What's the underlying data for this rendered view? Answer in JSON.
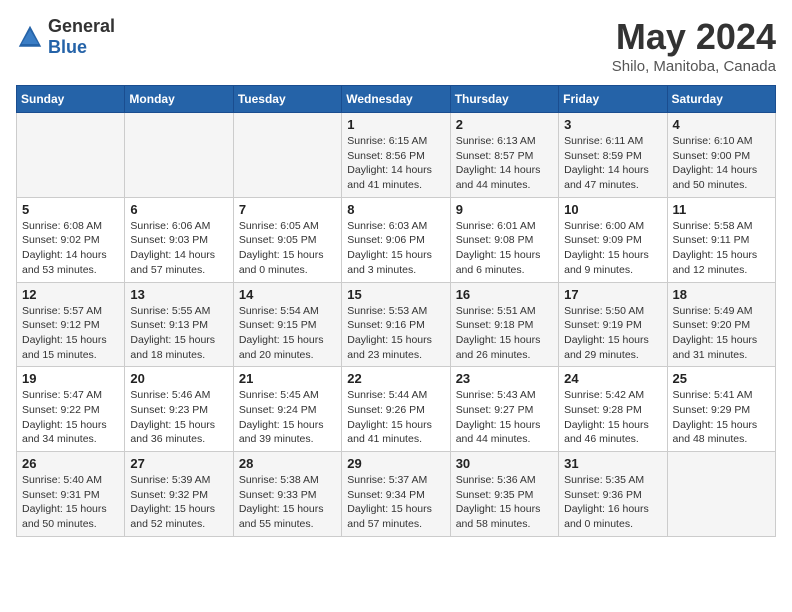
{
  "logo": {
    "text_general": "General",
    "text_blue": "Blue"
  },
  "title": "May 2024",
  "subtitle": "Shilo, Manitoba, Canada",
  "headers": [
    "Sunday",
    "Monday",
    "Tuesday",
    "Wednesday",
    "Thursday",
    "Friday",
    "Saturday"
  ],
  "weeks": [
    [
      {
        "day": "",
        "info": ""
      },
      {
        "day": "",
        "info": ""
      },
      {
        "day": "",
        "info": ""
      },
      {
        "day": "1",
        "info": "Sunrise: 6:15 AM\nSunset: 8:56 PM\nDaylight: 14 hours\nand 41 minutes."
      },
      {
        "day": "2",
        "info": "Sunrise: 6:13 AM\nSunset: 8:57 PM\nDaylight: 14 hours\nand 44 minutes."
      },
      {
        "day": "3",
        "info": "Sunrise: 6:11 AM\nSunset: 8:59 PM\nDaylight: 14 hours\nand 47 minutes."
      },
      {
        "day": "4",
        "info": "Sunrise: 6:10 AM\nSunset: 9:00 PM\nDaylight: 14 hours\nand 50 minutes."
      }
    ],
    [
      {
        "day": "5",
        "info": "Sunrise: 6:08 AM\nSunset: 9:02 PM\nDaylight: 14 hours\nand 53 minutes."
      },
      {
        "day": "6",
        "info": "Sunrise: 6:06 AM\nSunset: 9:03 PM\nDaylight: 14 hours\nand 57 minutes."
      },
      {
        "day": "7",
        "info": "Sunrise: 6:05 AM\nSunset: 9:05 PM\nDaylight: 15 hours\nand 0 minutes."
      },
      {
        "day": "8",
        "info": "Sunrise: 6:03 AM\nSunset: 9:06 PM\nDaylight: 15 hours\nand 3 minutes."
      },
      {
        "day": "9",
        "info": "Sunrise: 6:01 AM\nSunset: 9:08 PM\nDaylight: 15 hours\nand 6 minutes."
      },
      {
        "day": "10",
        "info": "Sunrise: 6:00 AM\nSunset: 9:09 PM\nDaylight: 15 hours\nand 9 minutes."
      },
      {
        "day": "11",
        "info": "Sunrise: 5:58 AM\nSunset: 9:11 PM\nDaylight: 15 hours\nand 12 minutes."
      }
    ],
    [
      {
        "day": "12",
        "info": "Sunrise: 5:57 AM\nSunset: 9:12 PM\nDaylight: 15 hours\nand 15 minutes."
      },
      {
        "day": "13",
        "info": "Sunrise: 5:55 AM\nSunset: 9:13 PM\nDaylight: 15 hours\nand 18 minutes."
      },
      {
        "day": "14",
        "info": "Sunrise: 5:54 AM\nSunset: 9:15 PM\nDaylight: 15 hours\nand 20 minutes."
      },
      {
        "day": "15",
        "info": "Sunrise: 5:53 AM\nSunset: 9:16 PM\nDaylight: 15 hours\nand 23 minutes."
      },
      {
        "day": "16",
        "info": "Sunrise: 5:51 AM\nSunset: 9:18 PM\nDaylight: 15 hours\nand 26 minutes."
      },
      {
        "day": "17",
        "info": "Sunrise: 5:50 AM\nSunset: 9:19 PM\nDaylight: 15 hours\nand 29 minutes."
      },
      {
        "day": "18",
        "info": "Sunrise: 5:49 AM\nSunset: 9:20 PM\nDaylight: 15 hours\nand 31 minutes."
      }
    ],
    [
      {
        "day": "19",
        "info": "Sunrise: 5:47 AM\nSunset: 9:22 PM\nDaylight: 15 hours\nand 34 minutes."
      },
      {
        "day": "20",
        "info": "Sunrise: 5:46 AM\nSunset: 9:23 PM\nDaylight: 15 hours\nand 36 minutes."
      },
      {
        "day": "21",
        "info": "Sunrise: 5:45 AM\nSunset: 9:24 PM\nDaylight: 15 hours\nand 39 minutes."
      },
      {
        "day": "22",
        "info": "Sunrise: 5:44 AM\nSunset: 9:26 PM\nDaylight: 15 hours\nand 41 minutes."
      },
      {
        "day": "23",
        "info": "Sunrise: 5:43 AM\nSunset: 9:27 PM\nDaylight: 15 hours\nand 44 minutes."
      },
      {
        "day": "24",
        "info": "Sunrise: 5:42 AM\nSunset: 9:28 PM\nDaylight: 15 hours\nand 46 minutes."
      },
      {
        "day": "25",
        "info": "Sunrise: 5:41 AM\nSunset: 9:29 PM\nDaylight: 15 hours\nand 48 minutes."
      }
    ],
    [
      {
        "day": "26",
        "info": "Sunrise: 5:40 AM\nSunset: 9:31 PM\nDaylight: 15 hours\nand 50 minutes."
      },
      {
        "day": "27",
        "info": "Sunrise: 5:39 AM\nSunset: 9:32 PM\nDaylight: 15 hours\nand 52 minutes."
      },
      {
        "day": "28",
        "info": "Sunrise: 5:38 AM\nSunset: 9:33 PM\nDaylight: 15 hours\nand 55 minutes."
      },
      {
        "day": "29",
        "info": "Sunrise: 5:37 AM\nSunset: 9:34 PM\nDaylight: 15 hours\nand 57 minutes."
      },
      {
        "day": "30",
        "info": "Sunrise: 5:36 AM\nSunset: 9:35 PM\nDaylight: 15 hours\nand 58 minutes."
      },
      {
        "day": "31",
        "info": "Sunrise: 5:35 AM\nSunset: 9:36 PM\nDaylight: 16 hours\nand 0 minutes."
      },
      {
        "day": "",
        "info": ""
      }
    ]
  ]
}
